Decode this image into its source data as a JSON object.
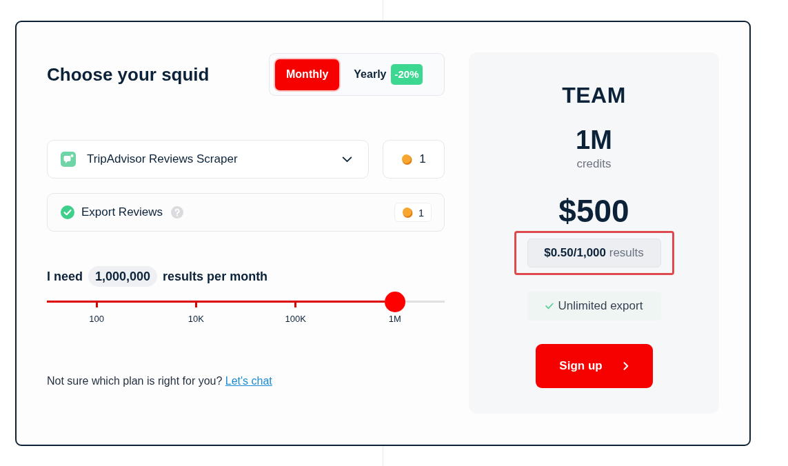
{
  "heading": "Choose your squid",
  "billing_toggle": [
    {
      "label": "Monthly",
      "selected": true
    },
    {
      "label": "Yearly",
      "selected": false,
      "badge": "-20%"
    }
  ],
  "actor_select": {
    "value": "TripAdvisor Reviews Scraper",
    "credits": "1"
  },
  "options": [
    {
      "label": "Export Reviews",
      "checked": true,
      "credits": "1"
    }
  ],
  "volume": {
    "prefix": "I need",
    "value": "1,000,000",
    "suffix": "results per month",
    "level": 0.875,
    "ticks": [
      "100",
      "10K",
      "100K",
      "1M"
    ]
  },
  "help": {
    "text": "Not sure which plan is right for you?",
    "link": "Let's chat"
  },
  "plan": {
    "name": "TEAM",
    "credits": "1M",
    "credits_label": "credits",
    "price": "$500",
    "unit_price": "**$0.50/1,000** results",
    "highlighted": true,
    "features": [
      "Unlimited export"
    ],
    "cta": "Sign up"
  }
}
